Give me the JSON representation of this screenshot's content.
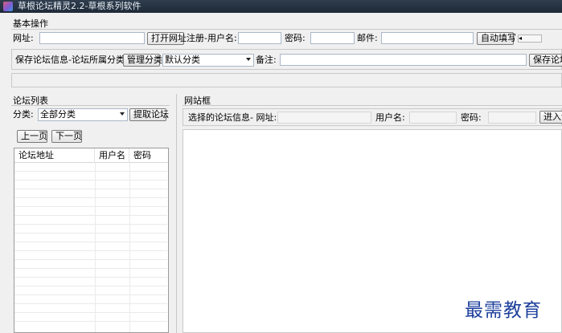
{
  "window": {
    "title": "草根论坛精灵2.2-草根系列软件"
  },
  "basic_ops": {
    "group_title": "基本操作",
    "url_label": "网址:",
    "url_value": "",
    "open_url_button": "打开网址",
    "register_username_label": "注册-用户名:",
    "password_label": "密码:",
    "email_label": "邮件:",
    "autofill_button": "自动填写",
    "save_forum_label": "保存论坛信息-论坛所属分类:",
    "manage_category_button": "管理分类",
    "category_select": "默认分类",
    "note_label": "备注:",
    "save_forum_button": "保存论坛"
  },
  "forum_list": {
    "group_title": "论坛列表",
    "category_label": "分类:",
    "category_select": "全部分类",
    "fetch_button": "提取论坛",
    "prev_page_button": "上一页",
    "next_page_button": "下一页",
    "columns": [
      "论坛地址",
      "用户名",
      "密码"
    ],
    "rows": []
  },
  "web_frame": {
    "group_title": "网站框",
    "selected_info_label": "选择的论坛信息- 网址:",
    "username_label": "用户名:",
    "password_label": "密码:",
    "enter_button": "进入论"
  },
  "watermark": "最需教育"
}
